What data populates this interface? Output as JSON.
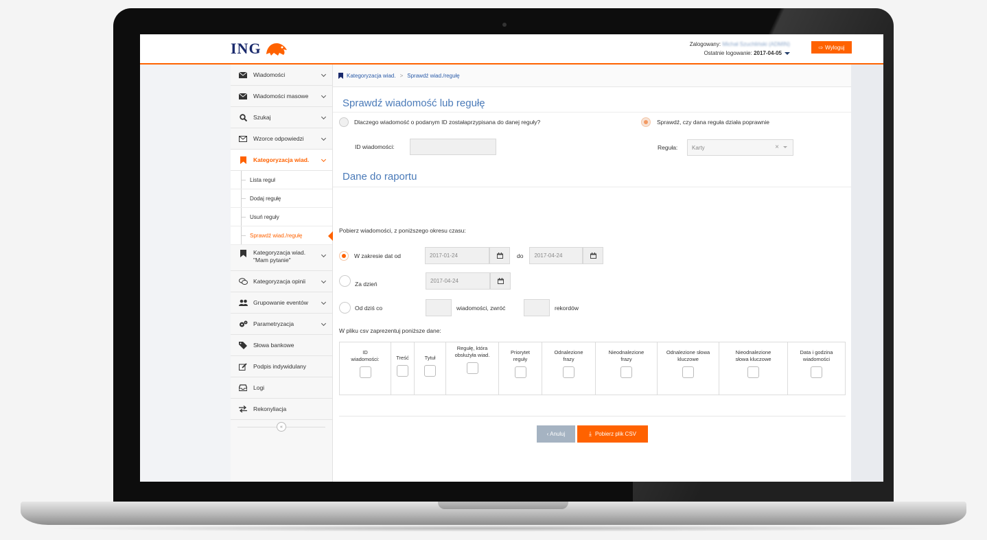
{
  "brand": {
    "logo_text": "ING",
    "accent": "#ff6200",
    "navy": "#1a2a6c"
  },
  "header": {
    "logged_label": "Zalogowany:",
    "logged_user": "Michał Szuchliński (ADMIN)",
    "last_login_label": "Ostatnie logowanie:",
    "last_login_date": "2017-04-05",
    "logout_label": "Wyloguj"
  },
  "sidebar": {
    "items": [
      {
        "label": "Wiadomości",
        "icon": "envelope-icon"
      },
      {
        "label": "Wiadomości masowe",
        "icon": "envelope-icon"
      },
      {
        "label": "Szukaj",
        "icon": "search-icon"
      },
      {
        "label": "Wzorce odpowiedzi",
        "icon": "envelope-outline-icon"
      },
      {
        "label": "Kategoryzacja wiad.",
        "icon": "bookmark-icon"
      }
    ],
    "sub_items": [
      "Lista reguł",
      "Dodaj regułę",
      "Usuń reguły",
      "Sprawdź wiad./regułę"
    ],
    "items_after": [
      {
        "label_line1": "Kategoryzacja wiad.",
        "label_line2": "\"Mam pytanie\"",
        "icon": "bookmark-icon"
      },
      {
        "label": "Kategoryzacja opinii",
        "icon": "comments-icon"
      },
      {
        "label": "Grupowanie eventów",
        "icon": "users-icon"
      },
      {
        "label": "Parametryzacja",
        "icon": "gears-icon"
      },
      {
        "label": "Słowa bankowe",
        "icon": "tags-icon"
      },
      {
        "label": "Podpis indywidulany",
        "icon": "edit-icon"
      },
      {
        "label": "Logi",
        "icon": "inbox-icon"
      },
      {
        "label": "Rekonyliacja",
        "icon": "exchange-icon"
      }
    ],
    "collapse_symbol": "«"
  },
  "breadcrumb": {
    "part1": "Kategoryzacja wiad.",
    "separator": ">",
    "part2": "Sprawdź wiad./regułę"
  },
  "check": {
    "title": "Sprawdź wiadomość lub regułę",
    "option1": "Dlaczego wiadomość o podanym ID zostałaprzypisana do danej reguły?",
    "option2": "Sprawdź, czy dana reguła działa poprawnie",
    "id_label": "ID wiadomości:",
    "id_value": "",
    "rule_label": "Reguła:",
    "rule_value": "Karty",
    "clear_symbol": "×"
  },
  "report": {
    "title": "Dane do raportu",
    "fetch_label": "Pobierz wiadomości, z poniższego okresu czasu:",
    "range_label": "W zakresie dat od",
    "date_from": "2017-01-24",
    "to_label": "do",
    "date_to": "2017-04-24",
    "day_label": "Za dzień",
    "day_value": "2017-04-24",
    "from_today_label": "Od dziś co",
    "messages_label": "wiadomości, zwróć",
    "records_label": "rekordów",
    "csv_label": "W pliku csv zaprezentuj poniższe dane:"
  },
  "csv_columns": [
    "ID wiadomości:",
    "Treść",
    "Tytuł",
    "Regułę, która obsłużyła wiad.",
    "Priorytet reguły",
    "Odnalezione frazy",
    "Nieodnalezione frazy",
    "Odnalezione słowa kluczowe",
    "Nieodnalezione słowa kluczowe",
    "Data i godzina wiadomości"
  ],
  "actions": {
    "cancel": "‹ Anuluj",
    "download": "Pobierz plik CSV"
  }
}
